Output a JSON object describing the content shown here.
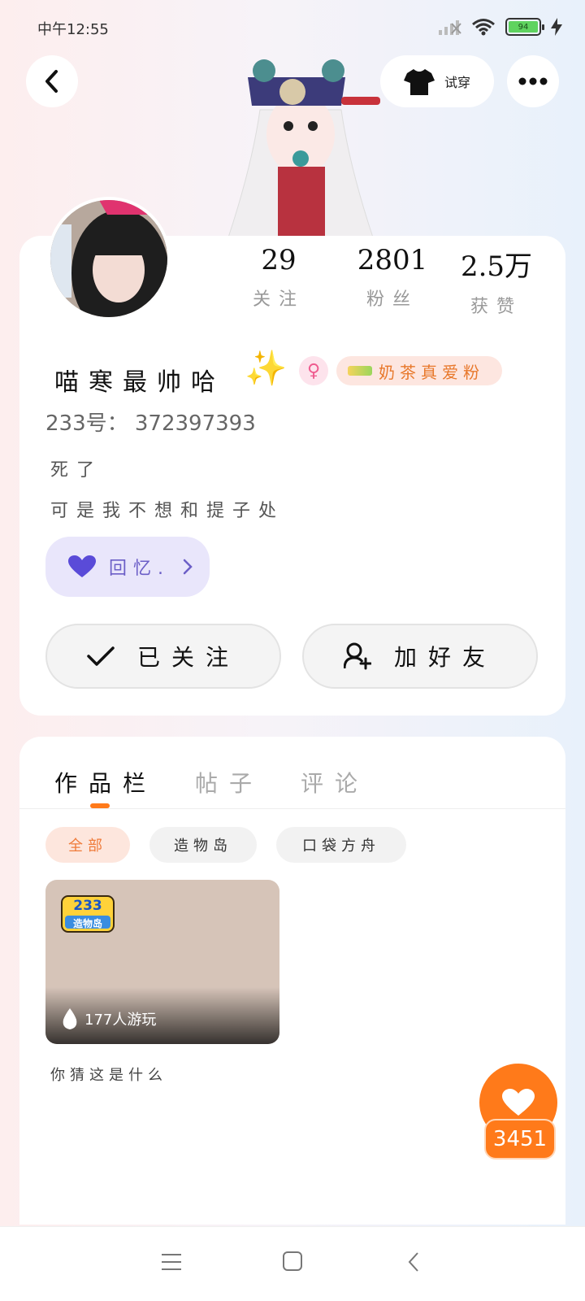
{
  "status_bar": {
    "time": "中午12:55",
    "battery_level": "94"
  },
  "header": {
    "tryon_label": "试穿"
  },
  "stats": [
    {
      "value": "29",
      "label": "关注"
    },
    {
      "value": "2801",
      "label": "粉丝"
    },
    {
      "value": "2.5万",
      "label": "获赞"
    }
  ],
  "profile": {
    "username": "喵寒最帅哈",
    "fan_badge": "奶茶真爱粉",
    "uid": "233号：  372397393",
    "bio_line1": "死了",
    "bio_line2": "可是我不想和提子处",
    "memory_label": "回忆."
  },
  "actions": {
    "followed_label": "已关注",
    "add_friend_label": "加好友"
  },
  "tabs": [
    {
      "label": "作品栏",
      "active": true
    },
    {
      "label": "帖子",
      "active": false
    },
    {
      "label": "评论",
      "active": false
    }
  ],
  "filters": [
    {
      "label": "全部",
      "active": true
    },
    {
      "label": "造物岛",
      "active": false
    },
    {
      "label": "口袋方舟",
      "active": false
    }
  ],
  "works": [
    {
      "logo_text": "233",
      "logo_sub": "造物岛",
      "plays": "177人游玩",
      "title": "你猜这是什么"
    }
  ],
  "like_count": "3451",
  "colors": {
    "accent": "#ff7a1a",
    "memory_chip": "#e9e6fb",
    "fan_badge_text": "#e8782b"
  }
}
